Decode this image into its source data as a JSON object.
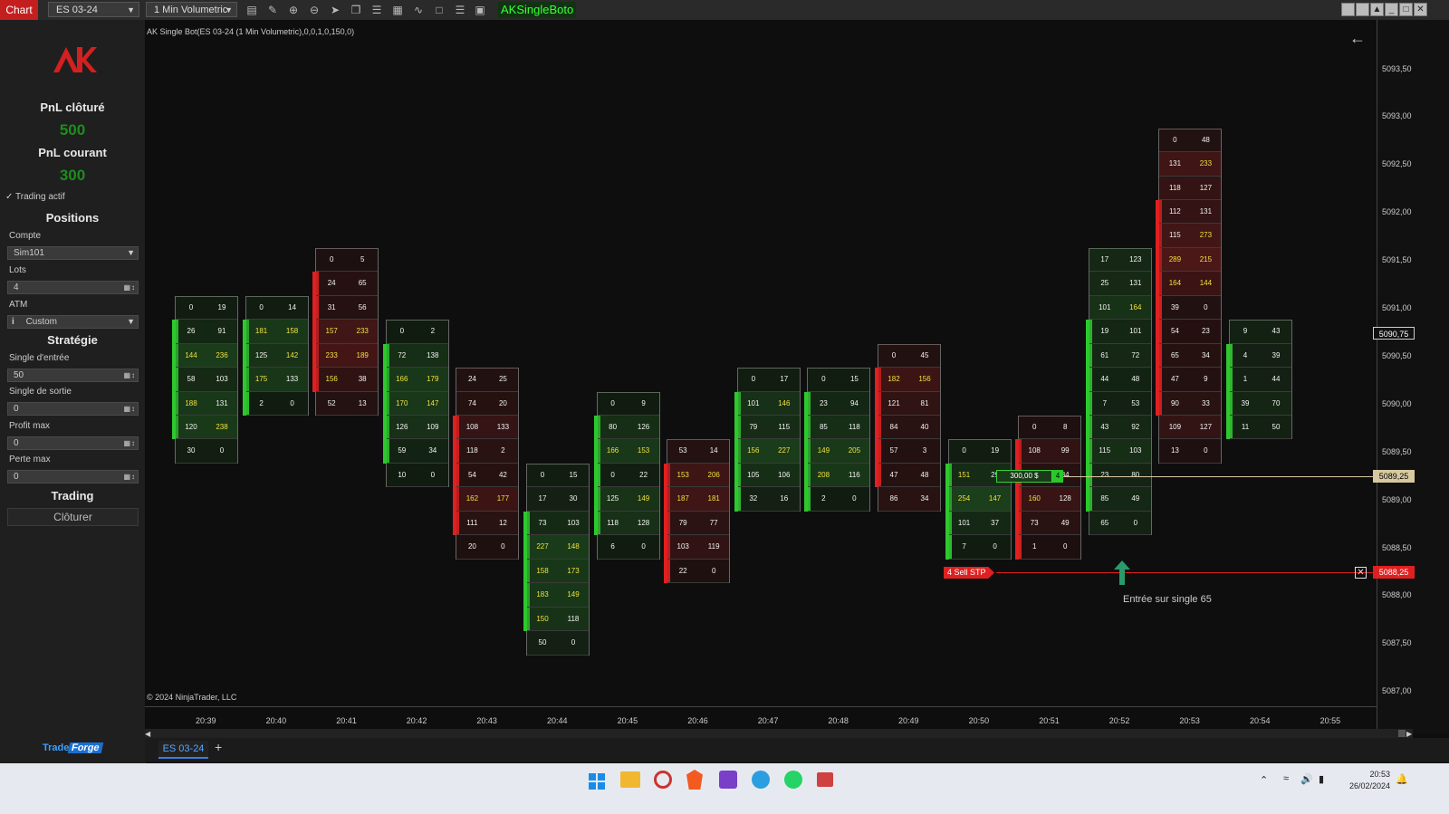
{
  "toolbar": {
    "chart_tab": "Chart",
    "instrument": "ES 03-24",
    "timeframe": "1 Min Volumetric",
    "strategy_name": "AKSingleBoto"
  },
  "panel": {
    "pnl_closed_label": "PnL clôturé",
    "pnl_closed_value": "500",
    "pnl_current_label": "PnL courant",
    "pnl_current_value": "300",
    "trading_active_label": "Trading actif",
    "trading_active_checked": true,
    "positions_label": "Positions",
    "account_label": "Compte",
    "account_value": "Sim101",
    "lots_label": "Lots",
    "lots_value": "4",
    "atm_label": "ATM",
    "atm_value": "Custom",
    "strategy_label": "Stratégie",
    "entry_label": "Single d'entrée",
    "entry_value": "50",
    "exit_label": "Single de sortie",
    "exit_value": "0",
    "profit_label": "Profit max",
    "profit_value": "0",
    "loss_label": "Perte max",
    "loss_value": "0",
    "trading_label": "Trading",
    "close_label": "Clôturer",
    "brand_a": "Trade",
    "brand_b": "Forge"
  },
  "chart": {
    "indicator_label": "AK Single Bot(ES 03-24 (1 Min Volumetric),0,0,1,0,150,0)",
    "copyright": "© 2024 NinjaTrader, LLC",
    "y_ticks": [
      "5093,50",
      "5093,00",
      "5092,50",
      "5092,00",
      "5091,50",
      "5091,00",
      "5090,50",
      "5090,00",
      "5089,50",
      "5089,00",
      "5088,50",
      "5088,00",
      "5087,50",
      "5087,00"
    ],
    "x_ticks": [
      "20:39",
      "20:40",
      "20:41",
      "20:42",
      "20:43",
      "20:44",
      "20:45",
      "20:46",
      "20:47",
      "20:48",
      "20:49",
      "20:50",
      "20:51",
      "20:52",
      "20:53",
      "20:54",
      "20:55"
    ],
    "current_price": "5090,75",
    "entry_price": "5089,25",
    "stop_price": "5088,25",
    "sell_stp_label": "4  Sell STP",
    "pnl_tag": "300,00 $",
    "pnl_tag_qty": "4",
    "annotation": "Entrée sur single 65",
    "corner_label": "F"
  },
  "chart_data": {
    "type": "table",
    "tick_size": 0.25,
    "bars": [
      {
        "time": "20:39",
        "top": 5091.0,
        "dir": "up",
        "bid": [
          0,
          26,
          144,
          58,
          188,
          120,
          30
        ],
        "ask": [
          19,
          91,
          236,
          103,
          131,
          238,
          0
        ]
      },
      {
        "time": "20:40",
        "top": 5091.0,
        "dir": "up",
        "bid": [
          0,
          181,
          125,
          175,
          2
        ],
        "ask": [
          14,
          158,
          142,
          133,
          0
        ]
      },
      {
        "time": "20:41",
        "top": 5091.5,
        "dir": "down",
        "bid": [
          0,
          24,
          31,
          157,
          233,
          156,
          52
        ],
        "ask": [
          5,
          65,
          56,
          233,
          189,
          38,
          13
        ]
      },
      {
        "time": "20:42",
        "top": 5090.75,
        "dir": "up",
        "bid": [
          0,
          72,
          166,
          170,
          126,
          59,
          10
        ],
        "ask": [
          2,
          138,
          179,
          147,
          109,
          34,
          0
        ]
      },
      {
        "time": "20:43",
        "top": 5090.25,
        "dir": "down",
        "bid": [
          24,
          74,
          108,
          118,
          54,
          162,
          111,
          20
        ],
        "ask": [
          25,
          20,
          133,
          2,
          42,
          177,
          12,
          0
        ]
      },
      {
        "time": "20:44",
        "top": 5089.25,
        "dir": "up",
        "bid": [
          0,
          17,
          73,
          227,
          158,
          183,
          150,
          50
        ],
        "ask": [
          15,
          30,
          103,
          148,
          173,
          149,
          118,
          0
        ]
      },
      {
        "time": "20:45",
        "top": 5090.0,
        "dir": "up",
        "bid": [
          0,
          80,
          166,
          0,
          125,
          118,
          6
        ],
        "ask": [
          9,
          126,
          153,
          22,
          149,
          128,
          0
        ]
      },
      {
        "time": "20:46",
        "top": 5089.5,
        "dir": "down",
        "bid": [
          53,
          153,
          187,
          79,
          103,
          22
        ],
        "ask": [
          14,
          206,
          181,
          77,
          119,
          0
        ]
      },
      {
        "time": "20:47",
        "top": 5090.25,
        "dir": "up",
        "bid": [
          0,
          101,
          79,
          156,
          105,
          32
        ],
        "ask": [
          17,
          146,
          115,
          227,
          106,
          16
        ]
      },
      {
        "time": "20:48",
        "top": 5090.25,
        "dir": "up",
        "bid": [
          0,
          23,
          85,
          149,
          208,
          2
        ],
        "ask": [
          15,
          94,
          118,
          205,
          116,
          0
        ]
      },
      {
        "time": "20:49",
        "top": 5090.5,
        "dir": "down",
        "bid": [
          0,
          182,
          121,
          84,
          57,
          47,
          86
        ],
        "ask": [
          45,
          156,
          81,
          40,
          3,
          48,
          34
        ]
      },
      {
        "time": "20:50",
        "top": 5089.5,
        "dir": "up",
        "bid": [
          0,
          151,
          254,
          101,
          7
        ],
        "ask": [
          19,
          29,
          147,
          37,
          0
        ]
      },
      {
        "time": "20:51",
        "top": 5089.75,
        "dir": "down",
        "bid": [
          0,
          108,
          4,
          160,
          73,
          1
        ],
        "ask": [
          8,
          99,
          84,
          128,
          49,
          0
        ]
      },
      {
        "time": "20:52",
        "top": 5091.5,
        "dir": "up",
        "bid": [
          17,
          25,
          101,
          19,
          61,
          44,
          7,
          43,
          115,
          23,
          85,
          65
        ],
        "ask": [
          123,
          131,
          164,
          101,
          72,
          48,
          53,
          92,
          103,
          80,
          49,
          0
        ]
      },
      {
        "time": "20:53",
        "top": 5092.75,
        "dir": "down",
        "bid": [
          0,
          131,
          118,
          112,
          115,
          289,
          164,
          39,
          54,
          65,
          47,
          90,
          109,
          13
        ],
        "ask": [
          48,
          233,
          127,
          131,
          273,
          215,
          144,
          0,
          23,
          34,
          9,
          33,
          127,
          0
        ]
      },
      {
        "time": "20:54",
        "top": 5090.75,
        "dir": "up",
        "bid": [
          9,
          4,
          1,
          39,
          11
        ],
        "ask": [
          43,
          39,
          44,
          70,
          50
        ]
      }
    ]
  },
  "bottom": {
    "tab": "ES 03-24",
    "add": "+"
  },
  "taskbar": {
    "time": "20:53",
    "date": "26/02/2024"
  }
}
